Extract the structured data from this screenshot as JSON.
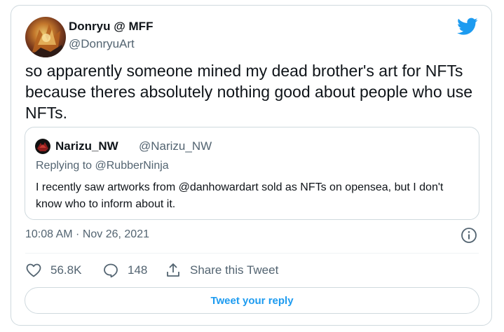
{
  "author": {
    "display_name": "Donryu @ MFF",
    "handle": "@DonryuArt"
  },
  "icons": {
    "brand": "twitter-bird-icon",
    "info": "info-icon",
    "like": "heart-icon",
    "reply": "speech-bubble-icon",
    "share": "share-upload-icon"
  },
  "colors": {
    "brand_blue": "#1d9bf0",
    "secondary_text": "#536471",
    "border": "#cfd9de"
  },
  "tweet": {
    "text": "so apparently someone mined my dead brother's art for NFTs because theres absolutely nothing good about people who use NFTs.",
    "timestamp": "10:08 AM · Nov 26, 2021"
  },
  "quoted_tweet": {
    "display_name": "Narizu_NW",
    "handle": "@Narizu_NW",
    "replying_to": "Replying to @RubberNinja",
    "text": "I recently saw artworks from @danhowardart sold as NFTs on opensea, but I don't know who to inform about it."
  },
  "actions": {
    "likes": "56.8K",
    "replies": "148",
    "share_label": "Share this Tweet"
  },
  "reply_button": {
    "label": "Tweet your reply"
  }
}
